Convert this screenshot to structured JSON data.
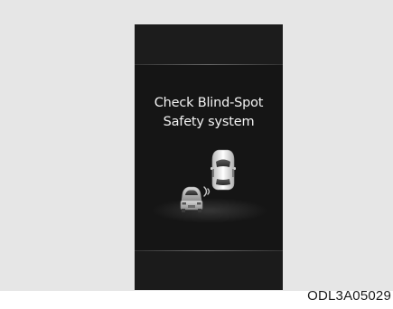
{
  "display": {
    "message_line1": "Check Blind-Spot",
    "message_line2": "Safety system"
  },
  "illustration": {
    "icons": [
      "own-vehicle-icon",
      "adjacent-vehicle-icon",
      "sensor-waves-icon"
    ]
  },
  "caption": {
    "code": "ODL3A05029"
  },
  "colors": {
    "frame": "#e6e6e6",
    "display": "#151515",
    "text": "#f2f2f2"
  }
}
